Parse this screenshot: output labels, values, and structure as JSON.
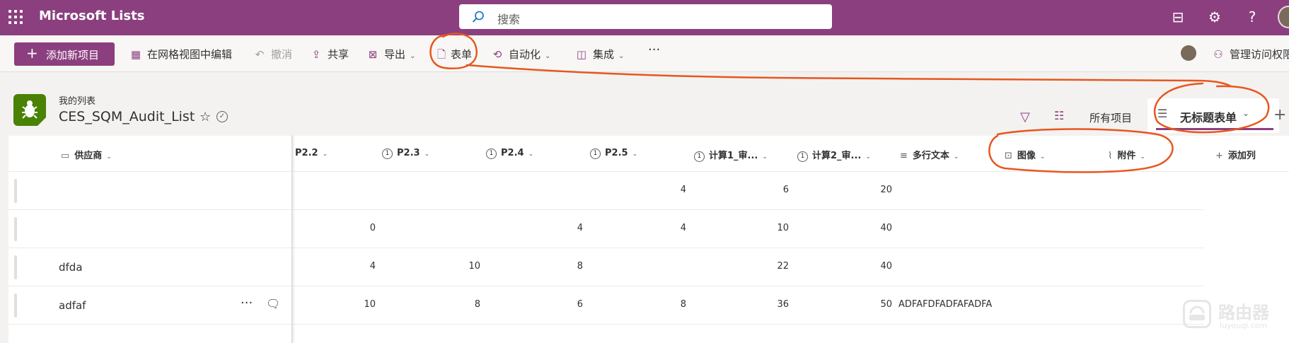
{
  "app": {
    "name": "Microsoft Lists"
  },
  "search": {
    "placeholder": "搜索"
  },
  "commands": {
    "add_new": "添加新项目",
    "grid_edit": "在网格视图中编辑",
    "undo": "撤消",
    "share": "共享",
    "export": "导出",
    "forms": "表单",
    "automate": "自动化",
    "integrate": "集成",
    "more": "···",
    "manage_access": "管理访问权限"
  },
  "list": {
    "breadcrumb": "我的列表",
    "title": "CES_SQM_Audit_List"
  },
  "views": {
    "all_items": "所有项目",
    "active_form": "无标题表单"
  },
  "columns": {
    "supplier": "供应商",
    "p22": "P2.2",
    "p23": "P2.3",
    "p24": "P2.4",
    "p25": "P2.5",
    "calc1": "计算1_审...",
    "calc2": "计算2_审...",
    "multiline": "多行文本",
    "image": "图像",
    "attachment": "附件",
    "add_column": "添加列"
  },
  "rows": [
    {
      "supplier": "",
      "p22": "",
      "p23": "",
      "p24": "",
      "p25": "4",
      "calc1": "6",
      "calc2": "20",
      "multiline": ""
    },
    {
      "supplier": "",
      "p22": "0",
      "p23": "",
      "p24": "4",
      "p25": "4",
      "calc1": "10",
      "calc2": "40",
      "multiline": ""
    },
    {
      "supplier": "dfda",
      "p22": "4",
      "p23": "10",
      "p24": "8",
      "p25": "",
      "calc1": "22",
      "calc2": "40",
      "multiline": ""
    },
    {
      "supplier": "adfaf",
      "p22": "10",
      "p23": "8",
      "p24": "6",
      "p25": "8",
      "calc1": "36",
      "calc2": "50",
      "multiline": "ADFAFDFADFAFADFA"
    }
  ],
  "watermark": {
    "text": "路由器",
    "url": "luyouqi.com"
  },
  "colors": {
    "brand": "#8b3f7f",
    "annotation": "#e8561e",
    "list_icon": "#498205"
  }
}
